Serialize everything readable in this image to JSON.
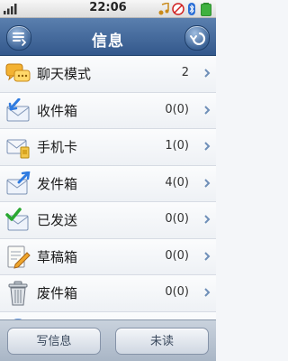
{
  "status_bar": {
    "time": "22:06"
  },
  "header": {
    "title": "信息"
  },
  "rows": [
    {
      "label": "聊天模式",
      "count": "2",
      "icon": "chat-bubbles-icon"
    },
    {
      "label": "收件箱",
      "count": "0(0)",
      "icon": "inbox-icon"
    },
    {
      "label": "手机卡",
      "count": "1(0)",
      "icon": "sim-envelope-icon"
    },
    {
      "label": "发件箱",
      "count": "4(0)",
      "icon": "outbox-icon"
    },
    {
      "label": "已发送",
      "count": "0(0)",
      "icon": "sent-check-icon"
    },
    {
      "label": "草稿箱",
      "count": "0(0)",
      "icon": "drafts-icon"
    },
    {
      "label": "废件箱",
      "count": "0(0)",
      "icon": "trash-icon"
    },
    {
      "label": "",
      "count": "",
      "icon": "broadcast-icon"
    }
  ],
  "bottom": {
    "write_label": "写信息",
    "unread_label": "未读"
  },
  "colors": {
    "header": "#3d6497",
    "accent_blue": "#3a7bd5",
    "chevron": "#6f8fb8"
  }
}
